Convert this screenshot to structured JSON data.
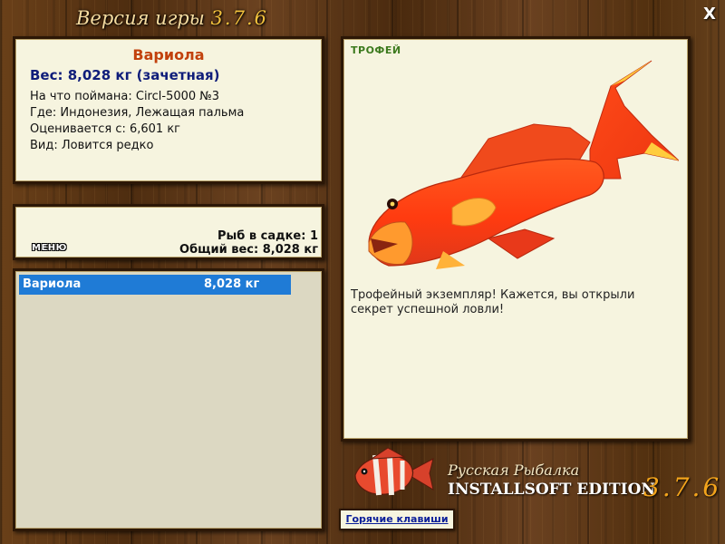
{
  "header": {
    "title": "Версия игры",
    "version": "3.7.6",
    "close_label": "X"
  },
  "fish_info": {
    "name": "Вариола",
    "weight": "Вес: 8,028 кг (зачетная)",
    "caught_with": "На что поймана: Circl-5000 №3",
    "location": "Где: Индонезия, Лежащая пальма",
    "rated_from": "Оценивается с: 6,601 кг",
    "kind": "Вид: Ловится редко"
  },
  "cage": {
    "menu_label": "МЕНЮ",
    "count": "Рыб в садке: 1",
    "total_weight": "Общий вес: 8,028 кг"
  },
  "catch_list": [
    {
      "name": "Вариола",
      "weight": "8,028 кг"
    }
  ],
  "trophy": {
    "label": "ТРОФЕЙ",
    "description": "Трофейный экземпляр! Кажется, вы открыли секрет успешной ловли!"
  },
  "branding": {
    "line1": "Русская Рыбалка",
    "line2": "INSTALLSOFT EDITION",
    "version": "3.7.6"
  },
  "hotkeys_label": "Горячие клавиши",
  "colors": {
    "selection": "#1f7bd6",
    "fish_name": "#c2410c",
    "weight_text": "#0f1d7a",
    "trophy_label": "#3c7a1e"
  }
}
